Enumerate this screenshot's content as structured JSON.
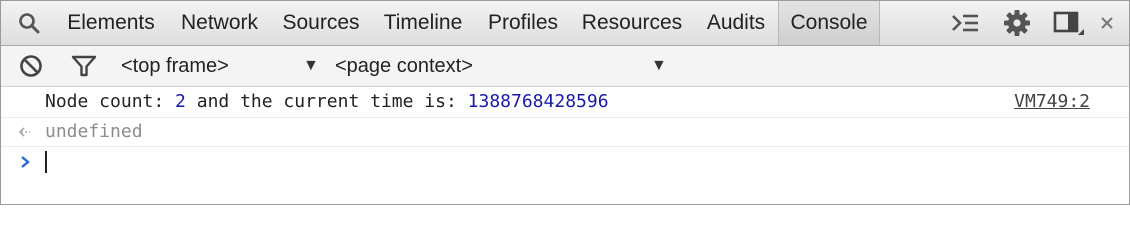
{
  "tabs": [
    {
      "label": "Elements",
      "selected": false
    },
    {
      "label": "Network",
      "selected": false
    },
    {
      "label": "Sources",
      "selected": false
    },
    {
      "label": "Timeline",
      "selected": false
    },
    {
      "label": "Profiles",
      "selected": false
    },
    {
      "label": "Resources",
      "selected": false
    },
    {
      "label": "Audits",
      "selected": false
    },
    {
      "label": "Console",
      "selected": true
    }
  ],
  "toolbar_icons": {
    "search": "search-icon",
    "drawer": "show-drawer-icon",
    "settings": "gear-icon",
    "dock": "dock-side-icon",
    "close": "close-icon"
  },
  "filter_bar": {
    "clear": "clear-console-icon",
    "filter": "filter-icon",
    "frame_select": "<top frame>",
    "context_select": "<page context>"
  },
  "messages": [
    {
      "type": "log",
      "prefix": "Node count: ",
      "count": "2",
      "middle": " and the current time is: ",
      "time": "1388768428596",
      "source": "VM749:2"
    },
    {
      "type": "result",
      "text": "undefined"
    }
  ],
  "colors": {
    "number": "#1a1aa6",
    "prompt_arrow": "#2a6ad8",
    "result_text": "#8c8c8c"
  }
}
